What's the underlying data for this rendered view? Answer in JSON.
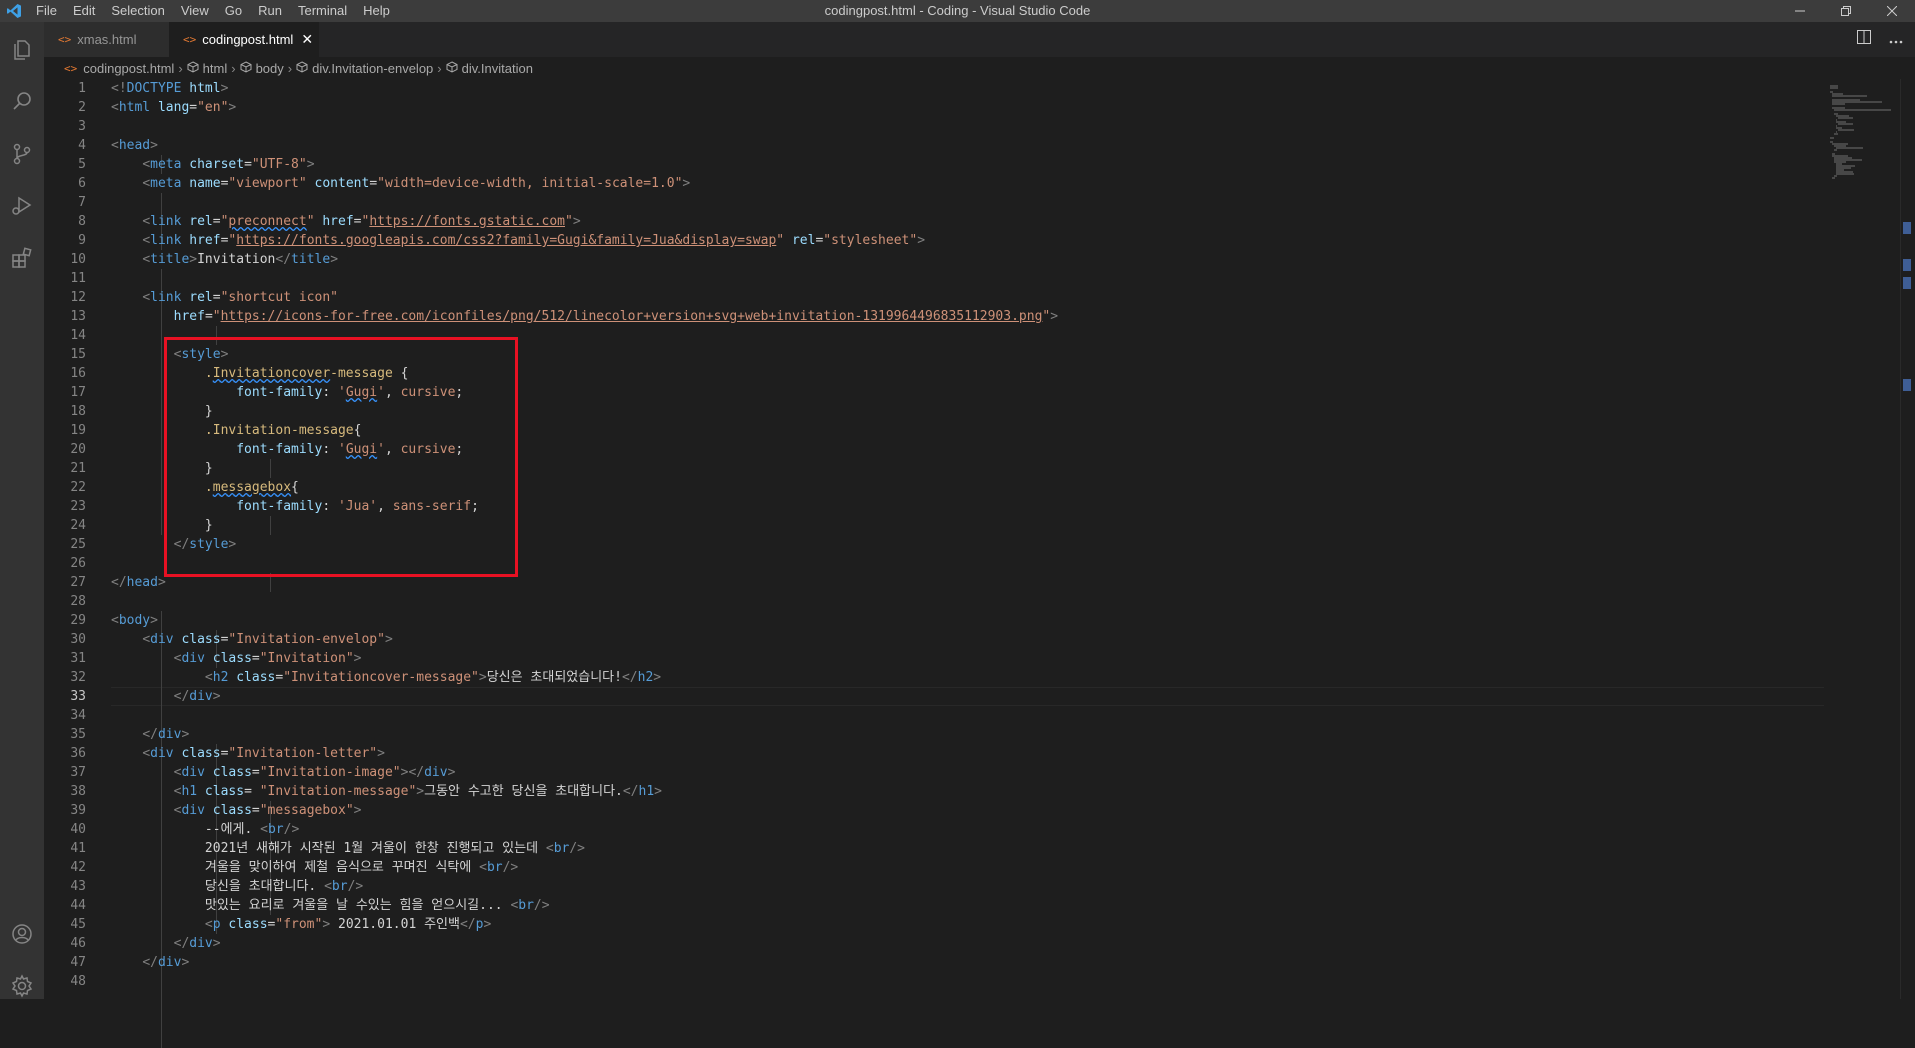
{
  "titlebar": {
    "title": "codingpost.html - Coding - Visual Studio Code",
    "menu": [
      "File",
      "Edit",
      "Selection",
      "View",
      "Go",
      "Run",
      "Terminal",
      "Help"
    ]
  },
  "tabs": [
    {
      "label": "xmas.html",
      "active": false
    },
    {
      "label": "codingpost.html",
      "active": true,
      "close": "✕"
    }
  ],
  "breadcrumb": [
    "codingpost.html",
    "html",
    "body",
    "div.Invitation-envelop",
    "div.Invitation"
  ],
  "current_line": 33,
  "colors": {
    "accent": "#007acc",
    "highlight_box": "#e81123",
    "html_icon": "#e37933"
  },
  "editor": {
    "lines": [
      {
        "n": "1",
        "t": [
          [
            "b",
            "<!"
          ],
          [
            "g",
            "DOCTYPE"
          ],
          [
            "a",
            " html"
          ],
          [
            "b",
            ">"
          ]
        ]
      },
      {
        "n": "2",
        "t": [
          [
            "b",
            "<"
          ],
          [
            "g",
            "html"
          ],
          [
            "a",
            " lang"
          ],
          [
            "x",
            "="
          ],
          [
            "s",
            "\"en\""
          ],
          [
            "b",
            ">"
          ]
        ]
      },
      {
        "n": "3",
        "t": []
      },
      {
        "n": "4",
        "t": [
          [
            "b",
            "<"
          ],
          [
            "g",
            "head"
          ],
          [
            "b",
            ">"
          ]
        ]
      },
      {
        "n": "5",
        "t": [
          [
            "x",
            "    "
          ],
          [
            "b",
            "<"
          ],
          [
            "g",
            "meta"
          ],
          [
            "a",
            " charset"
          ],
          [
            "x",
            "="
          ],
          [
            "s",
            "\"UTF-8\""
          ],
          [
            "b",
            ">"
          ]
        ]
      },
      {
        "n": "6",
        "t": [
          [
            "x",
            "    "
          ],
          [
            "b",
            "<"
          ],
          [
            "g",
            "meta"
          ],
          [
            "a",
            " name"
          ],
          [
            "x",
            "="
          ],
          [
            "s",
            "\"viewport\""
          ],
          [
            "a",
            " content"
          ],
          [
            "x",
            "="
          ],
          [
            "s",
            "\"width=device-width, initial-scale=1.0\""
          ],
          [
            "b",
            ">"
          ]
        ]
      },
      {
        "n": "7",
        "t": []
      },
      {
        "n": "8",
        "t": [
          [
            "x",
            "    "
          ],
          [
            "b",
            "<"
          ],
          [
            "g",
            "link"
          ],
          [
            "a",
            " rel"
          ],
          [
            "x",
            "="
          ],
          [
            "s",
            "\""
          ],
          [
            "ss",
            "preconnect"
          ],
          [
            "s",
            "\""
          ],
          [
            "a",
            " href"
          ],
          [
            "x",
            "="
          ],
          [
            "s",
            "\""
          ],
          [
            "u",
            "https://fonts.gstatic.com"
          ],
          [
            "s",
            "\""
          ],
          [
            "b",
            ">"
          ]
        ]
      },
      {
        "n": "9",
        "t": [
          [
            "x",
            "    "
          ],
          [
            "b",
            "<"
          ],
          [
            "g",
            "link"
          ],
          [
            "a",
            " href"
          ],
          [
            "x",
            "="
          ],
          [
            "s",
            "\""
          ],
          [
            "u",
            "https://fonts.googleapis.com/css2?family=Gugi&family=Jua&display=swap"
          ],
          [
            "s",
            "\""
          ],
          [
            "a",
            " rel"
          ],
          [
            "x",
            "="
          ],
          [
            "s",
            "\"stylesheet\""
          ],
          [
            "b",
            ">"
          ]
        ]
      },
      {
        "n": "10",
        "t": [
          [
            "x",
            "    "
          ],
          [
            "b",
            "<"
          ],
          [
            "g",
            "title"
          ],
          [
            "b",
            ">"
          ],
          [
            "x",
            "Invitation"
          ],
          [
            "b",
            "</"
          ],
          [
            "g",
            "title"
          ],
          [
            "b",
            ">"
          ]
        ]
      },
      {
        "n": "11",
        "t": []
      },
      {
        "n": "12",
        "t": [
          [
            "x",
            "    "
          ],
          [
            "b",
            "<"
          ],
          [
            "g",
            "link"
          ],
          [
            "a",
            " rel"
          ],
          [
            "x",
            "="
          ],
          [
            "s",
            "\"shortcut icon\""
          ]
        ]
      },
      {
        "n": "13",
        "t": [
          [
            "x",
            "        "
          ],
          [
            "a",
            "href"
          ],
          [
            "x",
            "="
          ],
          [
            "s",
            "\""
          ],
          [
            "u",
            "https://icons-for-free.com/iconfiles/png/512/linecolor+version+svg+web+invitation-1319964496835112903.png"
          ],
          [
            "s",
            "\""
          ],
          [
            "b",
            ">"
          ]
        ]
      },
      {
        "n": "14",
        "t": []
      },
      {
        "n": "15",
        "t": [
          [
            "x",
            "        "
          ],
          [
            "b",
            "<"
          ],
          [
            "g",
            "style"
          ],
          [
            "b",
            ">"
          ]
        ]
      },
      {
        "n": "16",
        "t": [
          [
            "x",
            "            "
          ],
          [
            "c",
            "."
          ],
          [
            "cs",
            "Invitationcover"
          ],
          [
            "c",
            "-message"
          ],
          [
            "x",
            " {"
          ]
        ]
      },
      {
        "n": "17",
        "t": [
          [
            "x",
            "                "
          ],
          [
            "p",
            "font-family"
          ],
          [
            "x",
            ": "
          ],
          [
            "s",
            "'"
          ],
          [
            "ss",
            "Gugi"
          ],
          [
            "s",
            "'"
          ],
          [
            "x",
            ", "
          ],
          [
            "s",
            "cursive"
          ],
          [
            "x",
            ";"
          ]
        ]
      },
      {
        "n": "18",
        "t": [
          [
            "x",
            "            }"
          ]
        ]
      },
      {
        "n": "19",
        "t": [
          [
            "x",
            "            "
          ],
          [
            "c",
            ".Invitation-message"
          ],
          [
            "x",
            "{"
          ]
        ]
      },
      {
        "n": "20",
        "t": [
          [
            "x",
            "                "
          ],
          [
            "p",
            "font-family"
          ],
          [
            "x",
            ": "
          ],
          [
            "s",
            "'"
          ],
          [
            "ss",
            "Gugi"
          ],
          [
            "s",
            "'"
          ],
          [
            "x",
            ", "
          ],
          [
            "s",
            "cursive"
          ],
          [
            "x",
            ";"
          ]
        ]
      },
      {
        "n": "21",
        "t": [
          [
            "x",
            "            }"
          ]
        ]
      },
      {
        "n": "22",
        "t": [
          [
            "x",
            "            "
          ],
          [
            "c",
            "."
          ],
          [
            "cs",
            "messagebox"
          ],
          [
            "x",
            "{"
          ]
        ]
      },
      {
        "n": "23",
        "t": [
          [
            "x",
            "                "
          ],
          [
            "p",
            "font-family"
          ],
          [
            "x",
            ": "
          ],
          [
            "s",
            "'Jua'"
          ],
          [
            "x",
            ", "
          ],
          [
            "s",
            "sans-serif"
          ],
          [
            "x",
            ";"
          ]
        ]
      },
      {
        "n": "24",
        "t": [
          [
            "x",
            "            }"
          ]
        ]
      },
      {
        "n": "25",
        "t": [
          [
            "x",
            "        "
          ],
          [
            "b",
            "</"
          ],
          [
            "g",
            "style"
          ],
          [
            "b",
            ">"
          ]
        ]
      },
      {
        "n": "26",
        "t": []
      },
      {
        "n": "27",
        "t": [
          [
            "b",
            "</"
          ],
          [
            "g",
            "head"
          ],
          [
            "b",
            ">"
          ]
        ]
      },
      {
        "n": "28",
        "t": []
      },
      {
        "n": "29",
        "t": [
          [
            "b",
            "<"
          ],
          [
            "g",
            "body"
          ],
          [
            "b",
            ">"
          ]
        ]
      },
      {
        "n": "30",
        "t": [
          [
            "x",
            "    "
          ],
          [
            "b",
            "<"
          ],
          [
            "g",
            "div"
          ],
          [
            "a",
            " class"
          ],
          [
            "x",
            "="
          ],
          [
            "s",
            "\"Invitation-envelop\""
          ],
          [
            "b",
            ">"
          ]
        ]
      },
      {
        "n": "31",
        "t": [
          [
            "x",
            "        "
          ],
          [
            "b",
            "<"
          ],
          [
            "g",
            "div"
          ],
          [
            "a",
            " class"
          ],
          [
            "x",
            "="
          ],
          [
            "s",
            "\"Invitation\""
          ],
          [
            "b",
            ">"
          ]
        ]
      },
      {
        "n": "32",
        "t": [
          [
            "x",
            "            "
          ],
          [
            "b",
            "<"
          ],
          [
            "g",
            "h2"
          ],
          [
            "a",
            " class"
          ],
          [
            "x",
            "="
          ],
          [
            "s",
            "\"Invitationcover-message\""
          ],
          [
            "b",
            ">"
          ],
          [
            "x",
            "당신은 초대되었습니다!"
          ],
          [
            "b",
            "</"
          ],
          [
            "g",
            "h2"
          ],
          [
            "b",
            ">"
          ]
        ]
      },
      {
        "n": "33",
        "t": [
          [
            "x",
            "        "
          ],
          [
            "b",
            "</"
          ],
          [
            "g",
            "div"
          ],
          [
            "b",
            ">"
          ]
        ]
      },
      {
        "n": "34",
        "t": []
      },
      {
        "n": "35",
        "t": [
          [
            "x",
            "    "
          ],
          [
            "b",
            "</"
          ],
          [
            "g",
            "div"
          ],
          [
            "b",
            ">"
          ]
        ]
      },
      {
        "n": "36",
        "t": [
          [
            "x",
            "    "
          ],
          [
            "b",
            "<"
          ],
          [
            "g",
            "div"
          ],
          [
            "a",
            " class"
          ],
          [
            "x",
            "="
          ],
          [
            "s",
            "\"Invitation-letter\""
          ],
          [
            "b",
            ">"
          ]
        ]
      },
      {
        "n": "37",
        "t": [
          [
            "x",
            "        "
          ],
          [
            "b",
            "<"
          ],
          [
            "g",
            "div"
          ],
          [
            "a",
            " class"
          ],
          [
            "x",
            "="
          ],
          [
            "s",
            "\"Invitation-image\""
          ],
          [
            "b",
            "></"
          ],
          [
            "g",
            "div"
          ],
          [
            "b",
            ">"
          ]
        ]
      },
      {
        "n": "38",
        "t": [
          [
            "x",
            "        "
          ],
          [
            "b",
            "<"
          ],
          [
            "g",
            "h1"
          ],
          [
            "a",
            " class"
          ],
          [
            "x",
            "= "
          ],
          [
            "s",
            "\"Invitation-message\""
          ],
          [
            "b",
            ">"
          ],
          [
            "x",
            "그동안 수고한 당신을 초대합니다."
          ],
          [
            "b",
            "</"
          ],
          [
            "g",
            "h1"
          ],
          [
            "b",
            ">"
          ]
        ]
      },
      {
        "n": "39",
        "t": [
          [
            "x",
            "        "
          ],
          [
            "b",
            "<"
          ],
          [
            "g",
            "div"
          ],
          [
            "a",
            " class"
          ],
          [
            "x",
            "="
          ],
          [
            "s",
            "\"messagebox\""
          ],
          [
            "b",
            ">"
          ]
        ]
      },
      {
        "n": "40",
        "t": [
          [
            "x",
            "            --에게. "
          ],
          [
            "b",
            "<"
          ],
          [
            "g",
            "br"
          ],
          [
            "b",
            "/>"
          ]
        ]
      },
      {
        "n": "41",
        "t": [
          [
            "x",
            "            2021년 새해가 시작된 1월 겨울이 한창 진행되고 있는데 "
          ],
          [
            "b",
            "<"
          ],
          [
            "g",
            "br"
          ],
          [
            "b",
            "/>"
          ]
        ]
      },
      {
        "n": "42",
        "t": [
          [
            "x",
            "            겨울을 맞이하여 제철 음식으로 꾸며진 식탁에 "
          ],
          [
            "b",
            "<"
          ],
          [
            "g",
            "br"
          ],
          [
            "b",
            "/>"
          ]
        ]
      },
      {
        "n": "43",
        "t": [
          [
            "x",
            "            당신을 초대합니다. "
          ],
          [
            "b",
            "<"
          ],
          [
            "g",
            "br"
          ],
          [
            "b",
            "/>"
          ]
        ]
      },
      {
        "n": "44",
        "t": [
          [
            "x",
            "            맛있는 요리로 겨울을 날 수있는 힘을 얻으시길... "
          ],
          [
            "b",
            "<"
          ],
          [
            "g",
            "br"
          ],
          [
            "b",
            "/>"
          ]
        ]
      },
      {
        "n": "45",
        "t": [
          [
            "x",
            "            "
          ],
          [
            "b",
            "<"
          ],
          [
            "g",
            "p"
          ],
          [
            "a",
            " class"
          ],
          [
            "x",
            "="
          ],
          [
            "s",
            "\"from\""
          ],
          [
            "b",
            ">"
          ],
          [
            "x",
            " 2021.01.01 주인백"
          ],
          [
            "b",
            "</"
          ],
          [
            "g",
            "p"
          ],
          [
            "b",
            ">"
          ]
        ]
      },
      {
        "n": "46",
        "t": [
          [
            "x",
            "        "
          ],
          [
            "b",
            "</"
          ],
          [
            "g",
            "div"
          ],
          [
            "b",
            ">"
          ]
        ]
      },
      {
        "n": "47",
        "t": [
          [
            "x",
            "    "
          ],
          [
            "b",
            "</"
          ],
          [
            "g",
            "div"
          ],
          [
            "b",
            ">"
          ]
        ]
      },
      {
        "n": "48",
        "t": []
      }
    ]
  }
}
